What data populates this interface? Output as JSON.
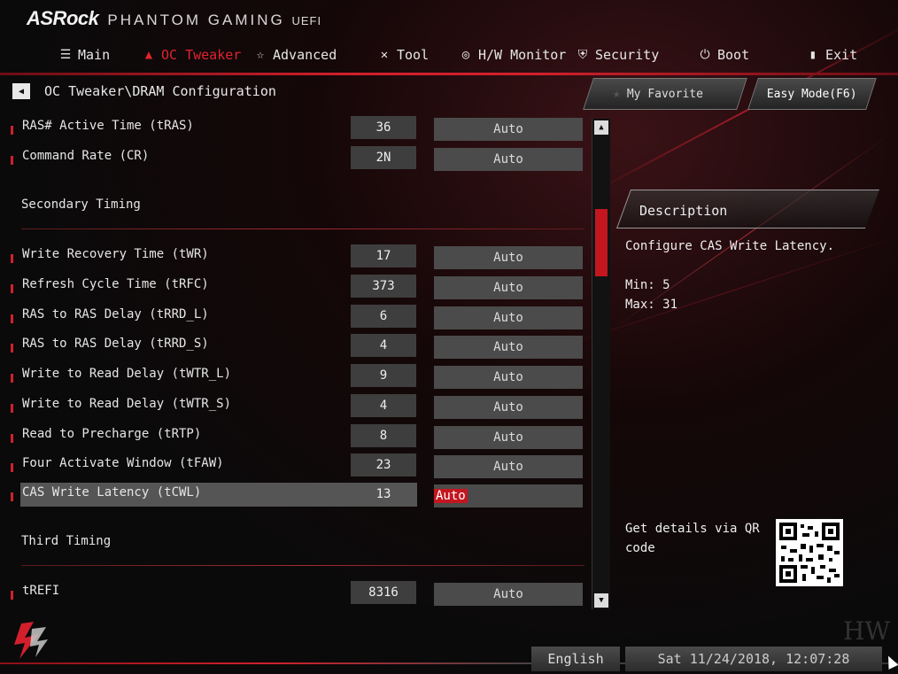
{
  "brand": {
    "logo": "ASRock",
    "subtitle": "PHANTOM GAMING",
    "uefi": "UEFI"
  },
  "tabs": [
    {
      "label": "Main",
      "icon": "list-icon"
    },
    {
      "label": "OC Tweaker",
      "icon": "flame-icon"
    },
    {
      "label": "Advanced",
      "icon": "star-icon"
    },
    {
      "label": "Tool",
      "icon": "tools-icon"
    },
    {
      "label": "H/W Monitor",
      "icon": "monitor-icon"
    },
    {
      "label": "Security",
      "icon": "shield-icon"
    },
    {
      "label": "Boot",
      "icon": "power-icon"
    },
    {
      "label": "Exit",
      "icon": "exit-icon"
    }
  ],
  "active_tab": "OC Tweaker",
  "breadcrumb": "OC Tweaker\\DRAM Configuration",
  "buttons": {
    "favorite": "My Favorite",
    "easy_mode": "Easy Mode(F6)"
  },
  "settings": {
    "tras": {
      "label": "RAS# Active Time (tRAS)",
      "value": "36",
      "option": "Auto"
    },
    "cr": {
      "label": "Command Rate (CR)",
      "value": "2N",
      "option": "Auto"
    },
    "secondary_header": "Secondary Timing",
    "twr": {
      "label": "Write Recovery Time (tWR)",
      "value": "17",
      "option": "Auto"
    },
    "trfc": {
      "label": "Refresh Cycle Time (tRFC)",
      "value": "373",
      "option": "Auto"
    },
    "trrdl": {
      "label": "RAS to RAS Delay (tRRD_L)",
      "value": "6",
      "option": "Auto"
    },
    "trrds": {
      "label": "RAS to RAS Delay (tRRD_S)",
      "value": "4",
      "option": "Auto"
    },
    "twtrl": {
      "label": "Write to Read Delay (tWTR_L)",
      "value": "9",
      "option": "Auto"
    },
    "twtrs": {
      "label": "Write to Read Delay (tWTR_S)",
      "value": "4",
      "option": "Auto"
    },
    "trtp": {
      "label": "Read to Precharge (tRTP)",
      "value": "8",
      "option": "Auto"
    },
    "tfaw": {
      "label": "Four Activate Window (tFAW)",
      "value": "23",
      "option": "Auto"
    },
    "tcwl": {
      "label": "CAS Write Latency (tCWL)",
      "value": "13",
      "option": "Auto"
    },
    "third_header": "Third Timing",
    "trefi": {
      "label": "tREFI",
      "value": "8316",
      "option": "Auto"
    }
  },
  "description": {
    "title": "Description",
    "text": "Configure CAS Write Latency.",
    "min": "Min: 5",
    "max": "Max: 31",
    "qr_text": "Get details via QR code"
  },
  "footer": {
    "language": "English",
    "datetime": "Sat 11/24/2018, 12:07:28"
  },
  "colors": {
    "accent": "#d1202c",
    "selected_option": "#c4161f"
  }
}
